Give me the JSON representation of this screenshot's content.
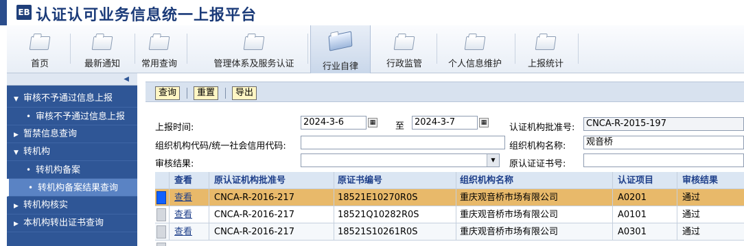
{
  "app": {
    "logo_text": "EB",
    "title": "认证认可业务信息统一上报平台"
  },
  "toolbar": {
    "items": [
      {
        "label": "首页"
      },
      {
        "label": "最新通知"
      },
      {
        "label": "常用查询"
      },
      {
        "label": "管理体系及服务认证"
      },
      {
        "label": "行业自律"
      },
      {
        "label": "行政监管"
      },
      {
        "label": "个人信息维护"
      },
      {
        "label": "上报统计"
      }
    ],
    "active_label": "行业自律"
  },
  "sidebar": {
    "collapse_icon": "◀",
    "items": [
      {
        "label": "审核不予通过信息上报",
        "expanded": true
      },
      {
        "label": "审核不予通过信息上报"
      },
      {
        "label": "暂禁信息查询",
        "expanded": false
      },
      {
        "label": "转机构",
        "expanded": true
      },
      {
        "label": "转机构备案"
      },
      {
        "label": "转机构备案结果查询",
        "selected": true
      },
      {
        "label": "转机构核实",
        "expanded": false
      },
      {
        "label": "本机构转出证书查询",
        "expanded": false
      }
    ]
  },
  "actions": {
    "query": "查询",
    "reset": "重置",
    "export": "导出"
  },
  "form": {
    "report_time_label": "上报时间:",
    "date_from": "2024-3-6",
    "to_label": "至",
    "date_to": "2024-3-7",
    "approval_no_label": "认证机构批准号:",
    "approval_no_value": "CNCA-R-2015-197",
    "org_code_label": "组织机构代码/统一社会信用代码:",
    "org_code_value": "",
    "org_name_label": "组织机构名称:",
    "org_name_value": "观音桥",
    "audit_result_label": "审核结果:",
    "audit_result_value": "",
    "orig_cert_label": "原认证证书号:",
    "orig_cert_value": ""
  },
  "table": {
    "columns": [
      "查看",
      "原认证机构批准号",
      "原证书编号",
      "组织机构名称",
      "认证项目",
      "审核结果"
    ],
    "rows": [
      {
        "view": "查看",
        "orig_approval": "CNCA-R-2016-217",
        "orig_cert": "18521E10270R0S",
        "org_name": "重庆观音桥市场有限公司",
        "item": "A0201",
        "result": "通过"
      },
      {
        "view": "查看",
        "orig_approval": "CNCA-R-2016-217",
        "orig_cert": "18521Q10282R0S",
        "org_name": "重庆观音桥市场有限公司",
        "item": "A0101",
        "result": "通过"
      },
      {
        "view": "查看",
        "orig_approval": "CNCA-R-2016-217",
        "orig_cert": "18521S10261R0S",
        "org_name": "重庆观音桥市场有限公司",
        "item": "A0301",
        "result": "通过"
      }
    ]
  },
  "colors": {
    "brand": "#1a3a78",
    "sidebar_bg": "#2f5696",
    "selected_row": "#e8b96a",
    "button_bg": "#fff6c4"
  }
}
